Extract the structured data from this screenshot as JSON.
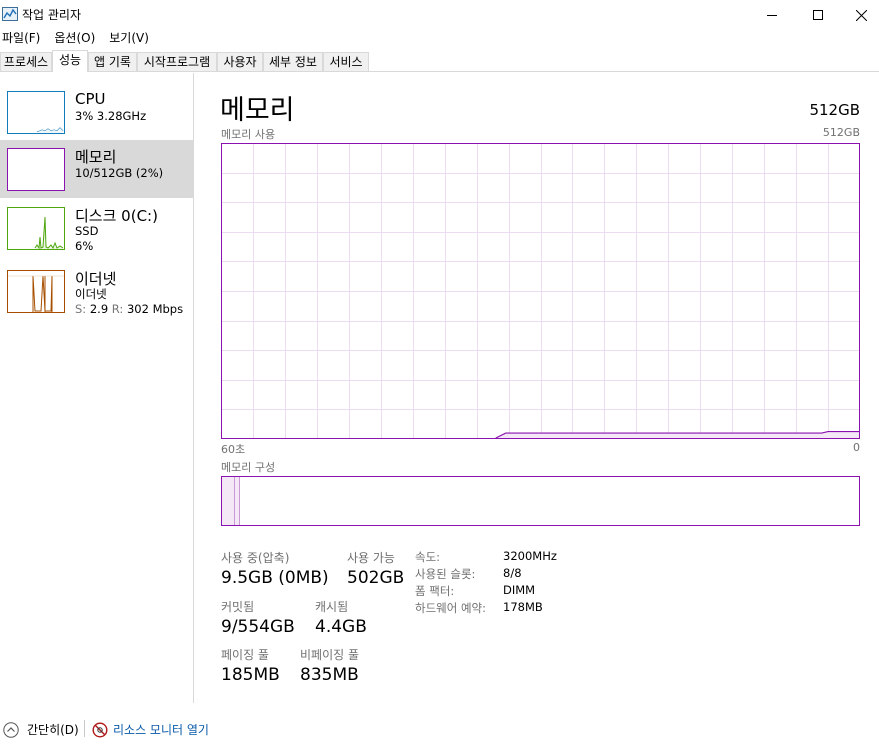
{
  "window": {
    "title": "작업 관리자",
    "controls": [
      "minimize-icon",
      "maximize-icon",
      "close-icon"
    ]
  },
  "menu": [
    "파일(F)",
    "옵션(O)",
    "보기(V)"
  ],
  "tabs": [
    {
      "label": "프로세스",
      "active": false
    },
    {
      "label": "성능",
      "active": true
    },
    {
      "label": "앱 기록",
      "active": false
    },
    {
      "label": "시작프로그램",
      "active": false
    },
    {
      "label": "사용자",
      "active": false
    },
    {
      "label": "세부 정보",
      "active": false
    },
    {
      "label": "서비스",
      "active": false
    }
  ],
  "sidebar": {
    "items": [
      {
        "name": "CPU",
        "lines": [
          "3% 3.28GHz"
        ],
        "color": "#117dbb",
        "selected": false
      },
      {
        "name": "메모리",
        "lines": [
          "10/512GB (2%)"
        ],
        "color": "#8b12ae",
        "selected": true
      },
      {
        "name": "디스크 0(C:)",
        "lines": [
          "SSD",
          "6%"
        ],
        "color": "#4da60c",
        "selected": false
      },
      {
        "name": "이더넷",
        "lines": [
          "이더넷"
        ],
        "net_send_label": "S:",
        "net_send": "2.9",
        "net_recv_label": "R:",
        "net_recv": "302 Mbps",
        "color": "#a74f01",
        "selected": false
      }
    ]
  },
  "main": {
    "title": "메모리",
    "total": "512GB",
    "usage_graph": {
      "label": "메모리 사용",
      "max_label": "512GB",
      "time_left": "60초",
      "time_right": "0",
      "line_color": "#8b12ae",
      "grid_color": "#ecdcf2",
      "usage_percent": 2
    },
    "composition": {
      "label": "메모리 구성",
      "in_use_percent": 2
    },
    "stats": {
      "in_use_label": "사용 중(압축)",
      "in_use_value": "9.5GB (0MB)",
      "available_label": "사용 가능",
      "available_value": "502GB",
      "committed_label": "커밋됨",
      "committed_value": "9/554GB",
      "cached_label": "캐시됨",
      "cached_value": "4.4GB",
      "paged_label": "페이징 풀",
      "paged_value": "185MB",
      "nonpaged_label": "비페이징 풀",
      "nonpaged_value": "835MB"
    },
    "details": [
      {
        "label": "속도:",
        "value": "3200MHz"
      },
      {
        "label": "사용된 슬롯:",
        "value": "8/8"
      },
      {
        "label": "폼 팩터:",
        "value": "DIMM"
      },
      {
        "label": "하드웨어 예약:",
        "value": "178MB"
      }
    ]
  },
  "footer": {
    "fewer_details": "간단히(D)",
    "resource_monitor": "리소스 모니터 열기"
  }
}
